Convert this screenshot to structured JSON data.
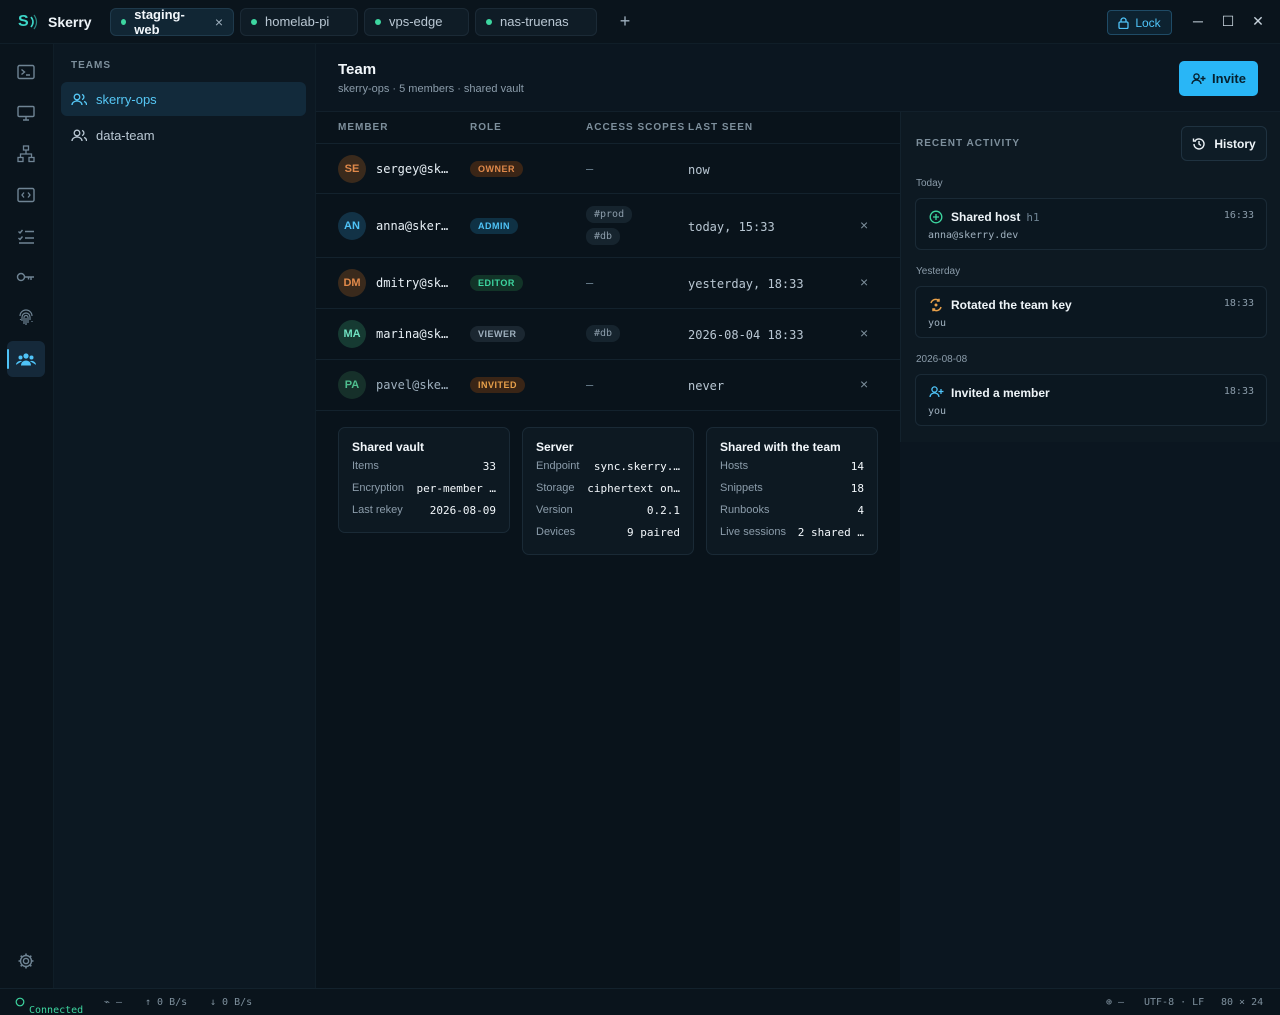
{
  "app": {
    "name": "Skerry",
    "logo_letter": "S"
  },
  "tabs": [
    {
      "label": "staging-web",
      "active": true
    },
    {
      "label": "homelab-pi"
    },
    {
      "label": "vps-edge"
    },
    {
      "label": "nas-truenas"
    }
  ],
  "tabs_close_icon": "×",
  "tabs_add_icon": "+",
  "lock_label": "Lock",
  "window_controls": {
    "minimize": "─",
    "maximize": "☐",
    "close": "✕"
  },
  "rail": {
    "icons": [
      "terminal-icon",
      "monitor-icon",
      "network-icon",
      "code-icon",
      "checklist-icon",
      "key-icon",
      "fingerprint-icon",
      "team-icon"
    ],
    "active": "team-icon",
    "settings_icon": "gear-icon"
  },
  "teams": {
    "title": "TEAMS",
    "items": [
      {
        "label": "skerry-ops",
        "active": true
      },
      {
        "label": "data-team"
      }
    ]
  },
  "header": {
    "title": "Team",
    "subtitle": "skerry-ops · 5 members · shared vault",
    "invite_label": "Invite"
  },
  "table": {
    "columns": [
      "MEMBER",
      "ROLE",
      "ACCESS SCOPES",
      "LAST SEEN"
    ],
    "rows": [
      {
        "initials": "SE",
        "member": "sergey@sk…",
        "role": "OWNER",
        "scopes": [],
        "scope_placeholder": "–",
        "last_seen": "now",
        "removable": false
      },
      {
        "initials": "AN",
        "member": "anna@sker…",
        "role": "ADMIN",
        "scopes": [
          "#prod",
          "#db"
        ],
        "last_seen": "today, 15:33",
        "removable": true
      },
      {
        "initials": "DM",
        "member": "dmitry@sk…",
        "role": "EDITOR",
        "scopes": [],
        "scope_placeholder": "–",
        "last_seen": "yesterday, 18:33",
        "removable": true
      },
      {
        "initials": "MA",
        "member": "marina@sk…",
        "role": "VIEWER",
        "scopes": [
          "#db"
        ],
        "last_seen": "2026-08-04 18:33",
        "removable": true
      },
      {
        "initials": "PA",
        "member": "pavel@ske…",
        "role": "INVITED",
        "scopes": [],
        "scope_placeholder": "–",
        "last_seen": "never",
        "removable": true
      }
    ],
    "remove_icon": "×"
  },
  "cards": {
    "vault": {
      "title": "Shared vault",
      "rows": [
        {
          "k": "Items",
          "v": "33"
        },
        {
          "k": "Encryption",
          "v": "per-member …"
        },
        {
          "k": "Last rekey",
          "v": "2026-08-09"
        }
      ]
    },
    "server": {
      "title": "Server",
      "rows": [
        {
          "k": "Endpoint",
          "v": "sync.skerry.…"
        },
        {
          "k": "Storage",
          "v": "ciphertext on…"
        },
        {
          "k": "Version",
          "v": "0.2.1"
        },
        {
          "k": "Devices",
          "v": "9 paired"
        }
      ]
    },
    "shared": {
      "title": "Shared with the team",
      "rows": [
        {
          "k": "Hosts",
          "v": "14"
        },
        {
          "k": "Snippets",
          "v": "18"
        },
        {
          "k": "Runbooks",
          "v": "4"
        },
        {
          "k": "Live sessions",
          "v": "2 shared …"
        }
      ]
    }
  },
  "activity": {
    "title": "RECENT ACTIVITY",
    "history_label": "History",
    "groups": [
      {
        "label": "Today",
        "items": [
          {
            "icon": "plus-circle-icon",
            "text": "Shared host",
            "extra": "h1",
            "by": "anna@skerry.dev",
            "time": "16:33"
          }
        ]
      },
      {
        "label": "Yesterday",
        "items": [
          {
            "icon": "rotate-key-icon",
            "text": "Rotated the team key",
            "extra": "",
            "by": "you",
            "time": "18:33"
          }
        ]
      },
      {
        "label": "2026-08-08",
        "items": [
          {
            "icon": "user-plus-icon",
            "text": "Invited a member",
            "extra": "",
            "by": "you",
            "time": "18:33"
          }
        ]
      }
    ]
  },
  "status": {
    "connection": "Connected",
    "ssh": "⌁ –",
    "up": "↑ 0 B/s",
    "down": "↓ 0 B/s",
    "encoding_left": "⊕ –",
    "encoding": "UTF-8 · LF",
    "size": "80 × 24"
  },
  "colors": {
    "accent": "#29b6f6",
    "teal": "#3dd6c8",
    "owner": "#e0894a",
    "admin": "#4fc3f7",
    "editor": "#3dd6a0",
    "viewer": "#9fb0be",
    "invited": "#e8a04a"
  }
}
